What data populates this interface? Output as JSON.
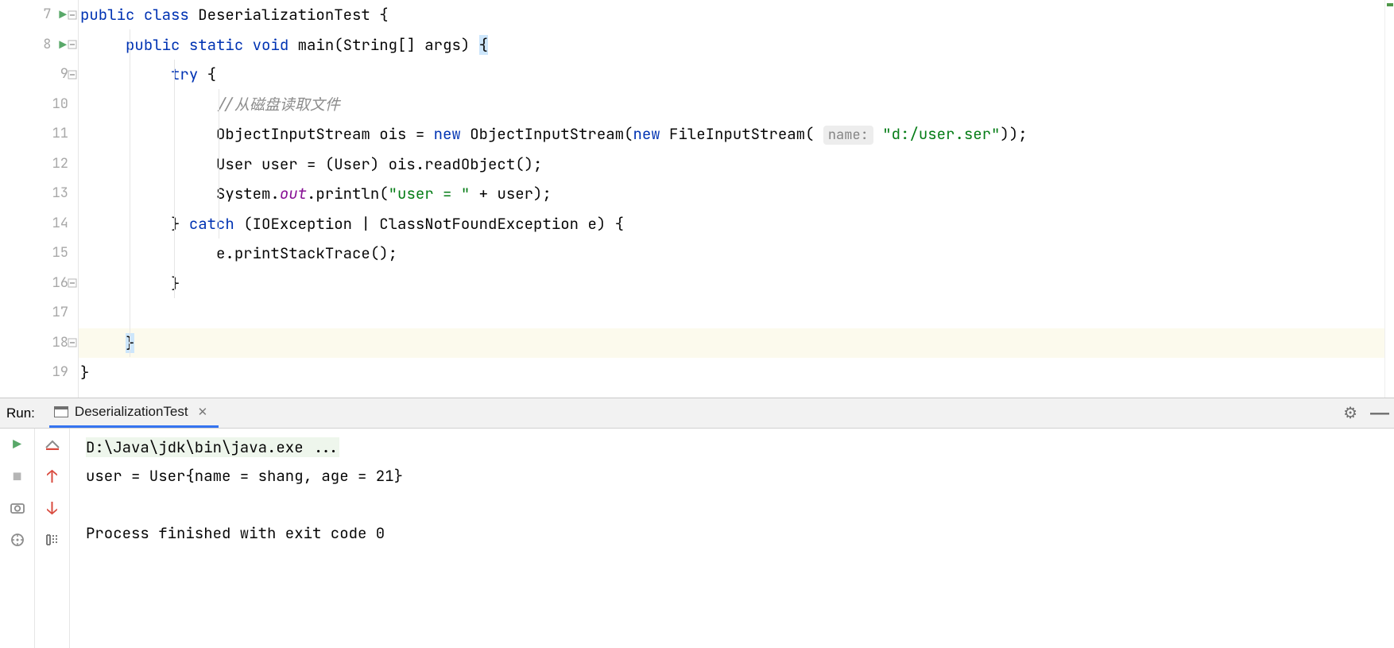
{
  "editor": {
    "lines": {
      "7": {
        "num": "7"
      },
      "8": {
        "num": "8"
      },
      "9": {
        "num": "9"
      },
      "10": {
        "num": "10"
      },
      "11": {
        "num": "11"
      },
      "12": {
        "num": "12"
      },
      "13": {
        "num": "13"
      },
      "14": {
        "num": "14"
      },
      "15": {
        "num": "15"
      },
      "16": {
        "num": "16"
      },
      "17": {
        "num": "17"
      },
      "18": {
        "num": "18"
      },
      "19": {
        "num": "19"
      }
    },
    "code": {
      "kw_public": "public",
      "kw_class": "class",
      "class_name": "DeserializationTest",
      "brace_open": "{",
      "kw_static": "static",
      "kw_void": "void",
      "method_main": "main",
      "main_params": "(String[] args) ",
      "kw_try": "try",
      "comment1": "//从磁盘读取文件",
      "l11_a": "ObjectInputStream ois = ",
      "kw_new": "new",
      "l11_b": " ObjectInputStream(",
      "l11_c": " FileInputStream( ",
      "param_hint": "name:",
      "l11_d": " ",
      "str1": "\"d:/user.ser\"",
      "l11_e": "));",
      "l12": "User user = (User) ois.readObject();",
      "l13_a": "System.",
      "field_out": "out",
      "l13_b": ".println(",
      "str2": "\"user = \"",
      "l13_c": " + user);",
      "l14_a": "} ",
      "kw_catch": "catch",
      "l14_b": " (IOException | ClassNotFoundException e) {",
      "l15": "e.printStackTrace();",
      "brace_close": "}"
    }
  },
  "run": {
    "label": "Run:",
    "tab_name": "DeserializationTest",
    "console_cmd": "D:\\Java\\jdk\\bin\\java.exe ...",
    "console_out1": "user = User{name = shang, age = 21}",
    "console_blank": "",
    "console_exit": "Process finished with exit code 0"
  }
}
